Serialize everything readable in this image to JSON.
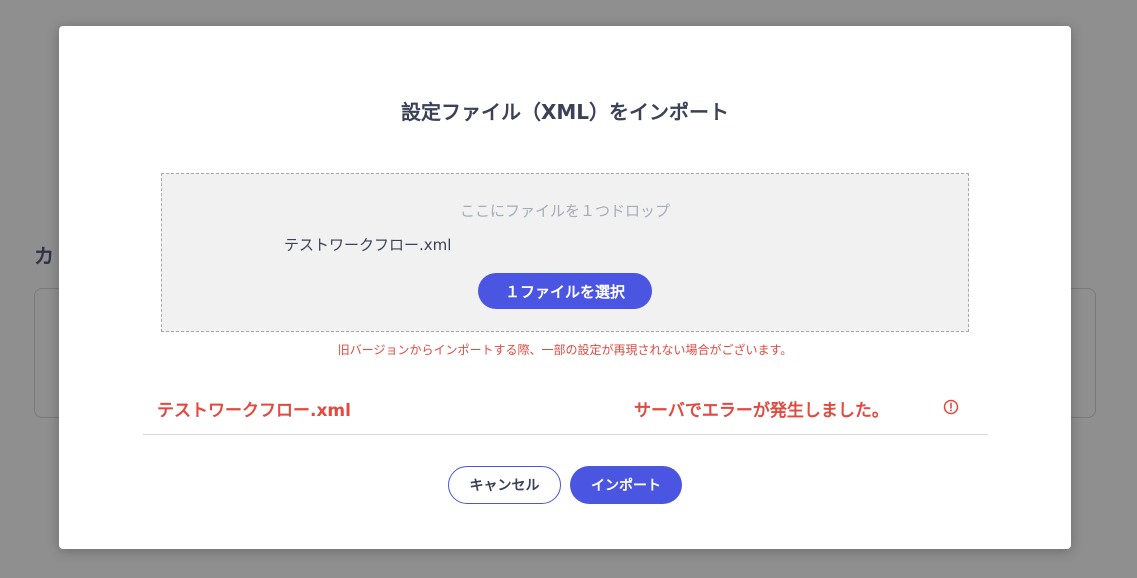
{
  "background": {
    "heading": "カ"
  },
  "modal": {
    "title": "設定ファイル（XML）をインポート",
    "dropzone": {
      "hint": "ここにファイルを１つドロップ",
      "selected_file": "テストワークフロー.xml",
      "select_button_label": "１ファイルを選択"
    },
    "warning": "旧バージョンからインポートする際、一部の設定が再現されない場合がございます。",
    "result": {
      "filename": "テストワークフロー.xml",
      "message": "サーバでエラーが発生しました。",
      "icon": "alert-circle-icon"
    },
    "buttons": {
      "cancel_label": "キャンセル",
      "import_label": "インポート"
    }
  },
  "colors": {
    "primary": "#4a56e2",
    "error": "#e2493f",
    "text": "#3b4257",
    "overlay": "#8f8f8f"
  }
}
